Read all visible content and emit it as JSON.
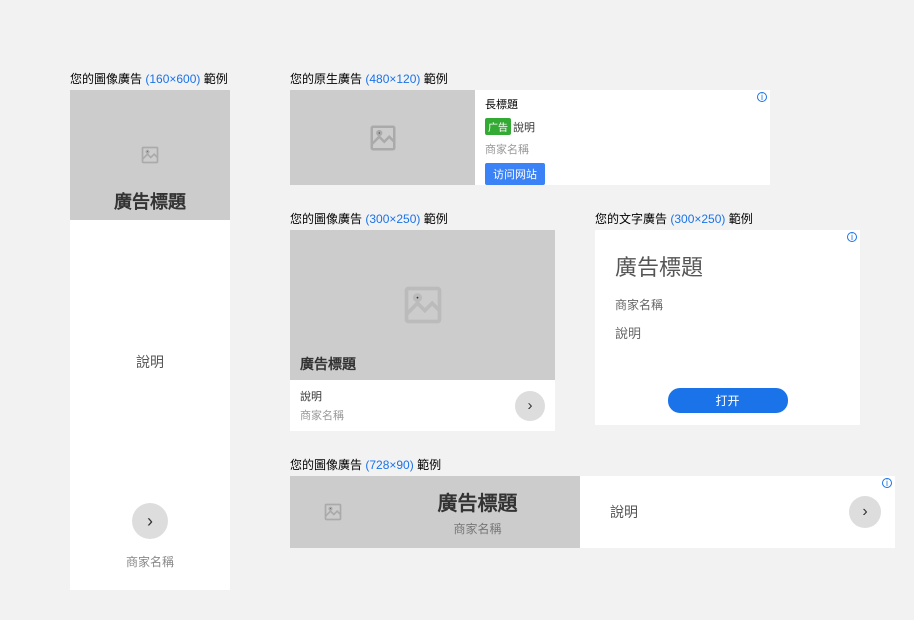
{
  "labels": {
    "prefix_image": "您的圖像廣告",
    "prefix_native": "您的原生廣告",
    "prefix_text": "您的文字廣告",
    "suffix": "範例",
    "size_160x600": "(160×600)",
    "size_480x120": "(480×120)",
    "size_300x250": "(300×250)",
    "size_728x90": "(728×90)"
  },
  "common": {
    "headline": "廣告標題",
    "long_headline": "長標題",
    "description": "說明",
    "business_name": "商家名稱",
    "ad_pill": "广告",
    "ad_desc_inline": "說明",
    "cta_visit": "访问网站",
    "cta_open": "打开"
  }
}
